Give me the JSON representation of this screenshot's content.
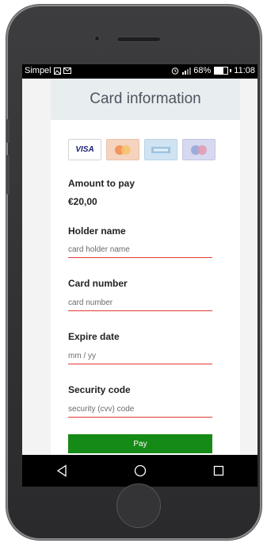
{
  "statusbar": {
    "carrier": "Simpel",
    "battery_percent": "68%",
    "battery_level": 0.68,
    "time": "11:08"
  },
  "header": {
    "title": "Card information"
  },
  "card_logos": [
    {
      "name": "visa",
      "text": "VISA"
    },
    {
      "name": "mastercard",
      "text": ""
    },
    {
      "name": "american-express",
      "text": ""
    },
    {
      "name": "maestro",
      "text": ""
    }
  ],
  "amount": {
    "label": "Amount to pay",
    "value": "€20,00"
  },
  "holder": {
    "label": "Holder name",
    "placeholder": "card holder name",
    "value": ""
  },
  "card_number": {
    "label": "Card number",
    "placeholder": "card number",
    "value": ""
  },
  "expire": {
    "label": "Expire date",
    "placeholder": "mm / yy",
    "value": ""
  },
  "cvv": {
    "label": "Security code",
    "placeholder": "security (cvv) code",
    "value": ""
  },
  "pay": {
    "label": "Pay"
  },
  "nav": {
    "back_icon": "triangle-back-icon",
    "home_icon": "circle-home-icon",
    "recents_icon": "square-recents-icon"
  },
  "colors": {
    "pay_button": "#168a16",
    "field_underline": "#e53935",
    "header_bg": "#e8edf0"
  }
}
